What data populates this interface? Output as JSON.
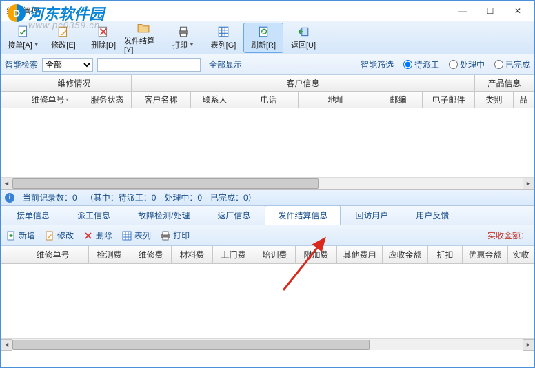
{
  "window": {
    "title": "维修管理"
  },
  "watermark": {
    "text": "河东软件园",
    "url": "www.pc0359.cn"
  },
  "toolbar": {
    "accept": "接单[A]",
    "edit": "修改[E]",
    "delete": "删除[D]",
    "settle": "发件结算[Y]",
    "print": "打印",
    "list": "表列[G]",
    "refresh": "刷新[R]",
    "back": "返回[U]"
  },
  "filter": {
    "smart_label": "智能检索",
    "scope_value": "全部",
    "showall": "全部显示",
    "smartfilter_label": "智能筛选",
    "r1": "待派工",
    "r2": "处理中",
    "r3": "已完成"
  },
  "grid1": {
    "group1": "维修情况",
    "group2": "客户信息",
    "group3": "产品信息",
    "cols": {
      "order_no": "维修单号",
      "status": "服务状态",
      "cust": "客户名称",
      "contact": "联系人",
      "phone": "电话",
      "addr": "地址",
      "zip": "邮编",
      "email": "电子邮件",
      "cat": "类别",
      "brand": "品"
    }
  },
  "status": {
    "count_label": "当前记录数：",
    "count_value": "0",
    "detail": "（其中：待派工：0　处理中：0　已完成：0）"
  },
  "tabs": {
    "t1": "接单信息",
    "t2": "派工信息",
    "t3": "故障检测/处理",
    "t4": "返厂信息",
    "t5": "发件结算信息",
    "t6": "回访用户",
    "t7": "用户反馈"
  },
  "subtoolbar": {
    "add": "新增",
    "edit": "修改",
    "delete": "删除",
    "list": "表列",
    "print": "打印",
    "amount": "实收金额："
  },
  "grid2": {
    "c1": "维修单号",
    "c2": "检测费",
    "c3": "维修费",
    "c4": "材料费",
    "c5": "上门费",
    "c6": "培训费",
    "c7": "附加费",
    "c8": "其他费用",
    "c9": "应收金额",
    "c10": "折扣",
    "c11": "优惠金额",
    "c12": "实收"
  }
}
